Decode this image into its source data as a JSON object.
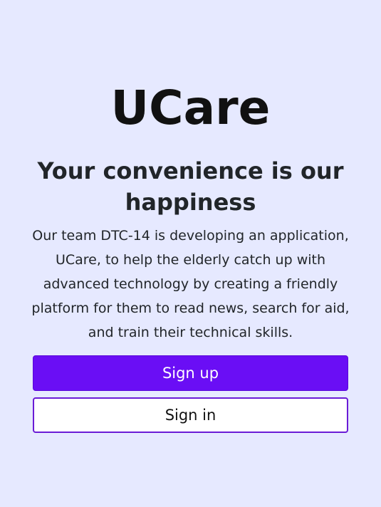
{
  "brand": {
    "logo_text": "UCare"
  },
  "hero": {
    "headline": "Your convenience is our happiness",
    "description": "Our team DTC-14 is developing an application, UCare, to help the elderly catch up with advanced technology by creating a friendly platform for them to read news, search for aid, and train their technical skills."
  },
  "actions": {
    "signup_label": "Sign up",
    "signin_label": "Sign in"
  },
  "colors": {
    "background": "#e6e9ff",
    "primary": "#6a0ef5",
    "outline": "#6a1bd6",
    "text": "#212529"
  }
}
